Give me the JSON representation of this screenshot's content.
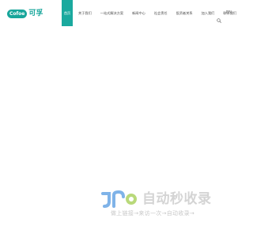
{
  "brand": {
    "pill_text": "Cofoe",
    "cn_name": "可孚",
    "accent": "#1aa99e"
  },
  "nav": {
    "items": [
      {
        "label": "首页",
        "active": true
      },
      {
        "label": "关于我们",
        "active": false
      },
      {
        "label": "一站式解决方案",
        "active": false
      },
      {
        "label": "新闻中心",
        "active": false
      },
      {
        "label": "社会责任",
        "active": false
      },
      {
        "label": "投资者关系",
        "active": false
      },
      {
        "label": "加入我们",
        "active": false
      },
      {
        "label": "联系我们",
        "active": false
      }
    ]
  },
  "header": {
    "search_icon": "search-icon",
    "lang_label": "EN"
  },
  "watermark": {
    "title": "自动秒收录",
    "subtitle": "做上链接→来访一次→自动收录→"
  }
}
